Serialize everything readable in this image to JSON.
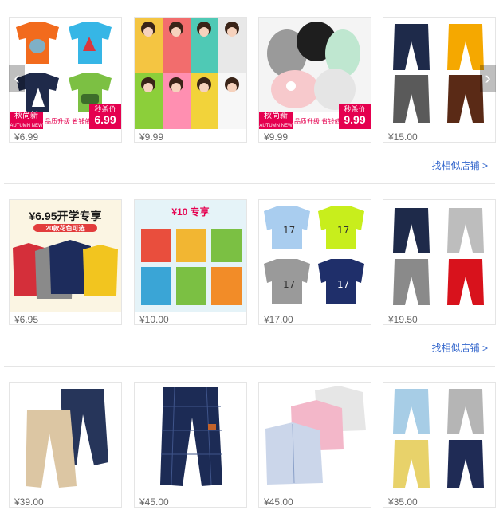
{
  "sections": [
    {
      "items": [
        {
          "price": "¥6.99",
          "promo": {
            "tag_line1": "秋尚新",
            "tag_line2": "AUTUMN NEW",
            "middle": "品质升级 省钱依旧",
            "sale_label": "秒杀价",
            "sale_price": "6.99"
          }
        },
        {
          "price": "¥9.99"
        },
        {
          "price": "¥9.99",
          "promo": {
            "tag_line1": "秋尚新",
            "tag_line2": "AUTUMN NEW",
            "middle": "品质升级 省钱依旧",
            "sale_label": "秒杀价",
            "sale_price": "9.99"
          }
        },
        {
          "price": "¥15.00"
        }
      ],
      "more_link": "找相似店铺 >"
    },
    {
      "items": [
        {
          "price": "¥6.95",
          "banner": {
            "headline": "¥6.95开学专享",
            "sub": "20款花色可选"
          }
        },
        {
          "price": "¥10.00",
          "banner": {
            "headline": "¥10 专享",
            "sub": ""
          }
        },
        {
          "price": "¥17.00"
        },
        {
          "price": "¥19.50"
        }
      ],
      "more_link": "找相似店铺 >"
    },
    {
      "items": [
        {
          "price": "¥39.00"
        },
        {
          "price": "¥45.00"
        },
        {
          "price": "¥45.00"
        },
        {
          "price": "¥35.00"
        }
      ]
    }
  ],
  "carousel": {
    "prev_icon": "chevron-left-icon",
    "next_icon": "chevron-right-icon"
  },
  "colors": {
    "link": "#3366cc",
    "promo": "#e5004f",
    "border": "#e5e5e5",
    "price": "#666666"
  }
}
